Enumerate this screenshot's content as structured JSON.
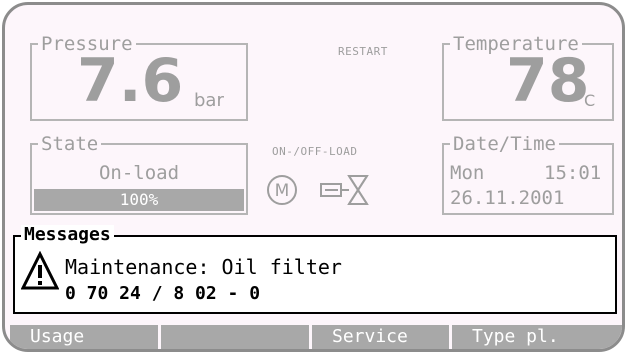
{
  "pressure": {
    "legend": "Pressure",
    "value": "7.6",
    "unit": "bar"
  },
  "restart_label": "RESTART",
  "temperature": {
    "legend": "Temperature",
    "value": "78",
    "unit": "°C"
  },
  "state": {
    "legend": "State",
    "value": "On-load",
    "load_percent": 100,
    "load_label": "100%"
  },
  "on_off_load_label": "ON-/OFF-LOAD",
  "motor_symbol": "M",
  "datetime": {
    "legend": "Date/Time",
    "day": "Mon",
    "time": "15:01",
    "date": "26.11.2001"
  },
  "messages": {
    "legend": "Messages",
    "line1": "Maintenance: Oil filter",
    "line2": "0 70 24 / 8 02 - 0"
  },
  "softkeys": [
    "Usage",
    "",
    "Service",
    "Type pl."
  ],
  "colors": {
    "display_bg": "#fdf6fb",
    "inactive_grey": "#9e9e9e",
    "softkey_bg": "#a8a8a8"
  },
  "icons": {
    "motor": "motor-icon",
    "valve": "valve-icon",
    "warning": "warning-icon"
  }
}
